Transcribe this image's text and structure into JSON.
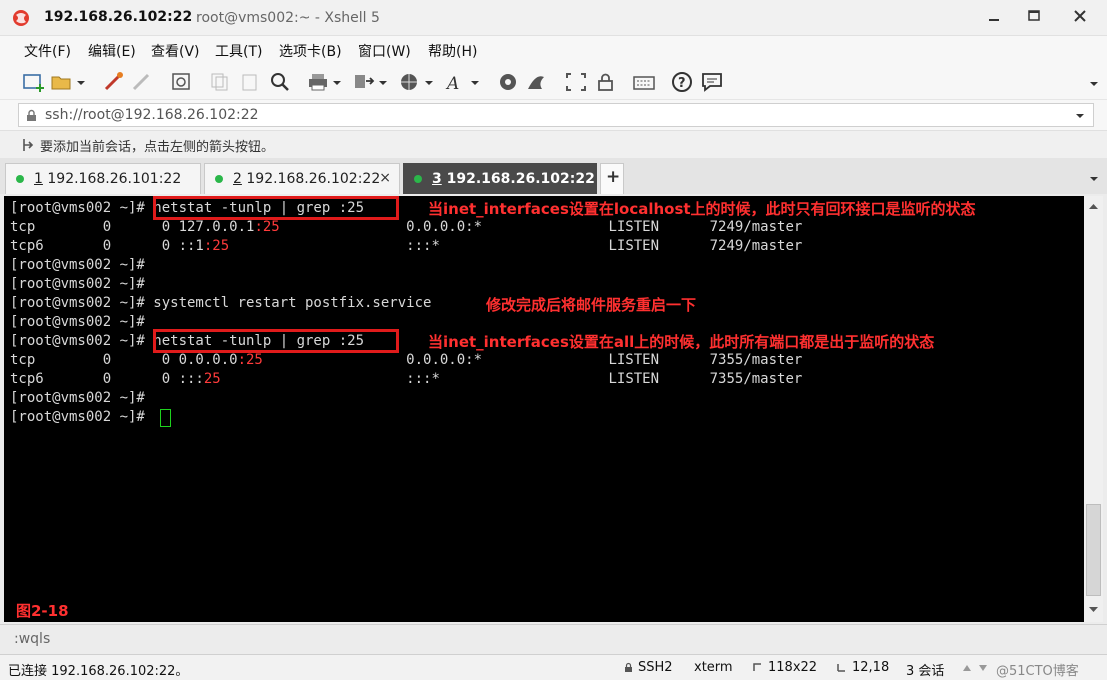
{
  "window": {
    "host_title": "192.168.26.102:22",
    "subtitle": "root@vms002:~ - Xshell 5"
  },
  "menu": [
    "文件(F)",
    "编辑(E)",
    "查看(V)",
    "工具(T)",
    "选项卡(B)",
    "窗口(W)",
    "帮助(H)"
  ],
  "address": {
    "value": "ssh://root@192.168.26.102:22"
  },
  "hint": "要添加当前会话，点击左侧的箭头按钮。",
  "tabs": [
    {
      "num": "1",
      "label": "192.168.26.101:22",
      "active": false
    },
    {
      "num": "2",
      "label": "192.168.26.102:22",
      "active": false
    },
    {
      "num": "3",
      "label": "192.168.26.102:22",
      "active": true
    }
  ],
  "terminal": {
    "prompt": "[root@vms002 ~]#",
    "cmd_netstat": " netstat -tunlp | grep :25",
    "cmd_restart": " systemctl restart postfix.service",
    "out1_a": "tcp        0      0 127.0.0.1",
    "out1_b": ":25",
    "out1_c": "               0.0.0.0:*               LISTEN      7249/master",
    "out2_a": "tcp6       0      0 ::1",
    "out2_b": ":25",
    "out2_c": "                     :::*                    LISTEN      7249/master",
    "out3_a": "tcp        0      0 0.0.0.0",
    "out3_b": ":25",
    "out3_c": "                 0.0.0.0:*               LISTEN      7355/master",
    "out4_a": "tcp6       0      0 :::",
    "out4_b": "25",
    "out4_c": "                      :::*                    LISTEN      7355/master"
  },
  "annotations": {
    "a1": "当inet_interfaces设置在localhost上的时候，此时只有回环接口是监听的状态",
    "a2": "修改完成后将邮件服务重启一下",
    "a3": "当inet_interfaces设置在all上的时候，此时所有端口都是出于监听的状态",
    "figure": "图2-18"
  },
  "cmdline": ":wqls",
  "status": {
    "connection": "已连接 192.168.26.102:22。",
    "protocol": "SSH2",
    "terminal_type": "xterm",
    "size": "118x22",
    "cursor_pos": "12,18",
    "sessions": "3 会话",
    "watermark": "@51CTO博客"
  },
  "colors": {
    "accent_red": "#e01b1b",
    "cursor_green": "#1ed11e",
    "status_dot": "#2bb74a"
  }
}
